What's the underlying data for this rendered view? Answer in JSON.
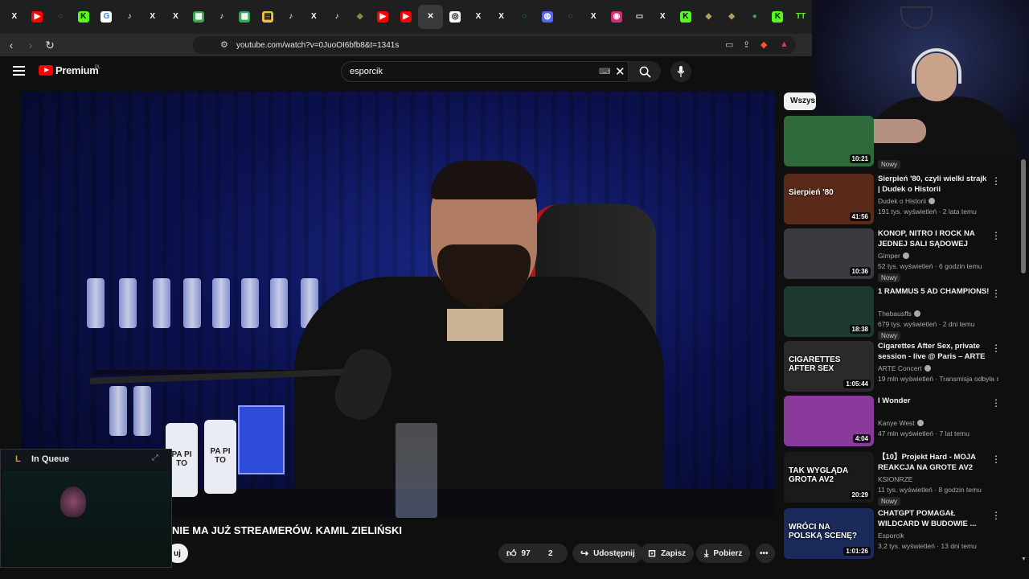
{
  "browser": {
    "tabs": [
      {
        "icon": "x-icon",
        "glyph": "X",
        "color": "#ffffff",
        "bg": "transparent"
      },
      {
        "icon": "youtube-icon",
        "glyph": "▶",
        "color": "#ffffff",
        "bg": "#ff0000"
      },
      {
        "icon": "refresh-icon",
        "glyph": "◌",
        "color": "#19c3a9",
        "bg": "transparent"
      },
      {
        "icon": "kick-icon",
        "glyph": "K",
        "color": "#000000",
        "bg": "#53fc18"
      },
      {
        "icon": "google-icon",
        "glyph": "G",
        "color": "#4285f4",
        "bg": "#ffffff"
      },
      {
        "icon": "tiktok-icon",
        "glyph": "♪",
        "color": "#ffffff",
        "bg": "transparent"
      },
      {
        "icon": "x-icon",
        "glyph": "X",
        "color": "#ffffff",
        "bg": "transparent"
      },
      {
        "icon": "x-icon",
        "glyph": "X",
        "color": "#ffffff",
        "bg": "transparent"
      },
      {
        "icon": "sheets-icon",
        "glyph": "▦",
        "color": "#ffffff",
        "bg": "#34a853"
      },
      {
        "icon": "tiktok-icon",
        "glyph": "♪",
        "color": "#ffffff",
        "bg": "transparent"
      },
      {
        "icon": "sheets-icon",
        "glyph": "▦",
        "color": "#ffffff",
        "bg": "#34a853"
      },
      {
        "icon": "doc-icon",
        "glyph": "▤",
        "color": "#000000",
        "bg": "#f0c040"
      },
      {
        "icon": "tiktok-icon",
        "glyph": "♪",
        "color": "#ffffff",
        "bg": "transparent"
      },
      {
        "icon": "x-icon",
        "glyph": "X",
        "color": "#ffffff",
        "bg": "transparent"
      },
      {
        "icon": "tiktok-icon",
        "glyph": "♪",
        "color": "#ffffff",
        "bg": "transparent"
      },
      {
        "icon": "leaf-icon",
        "glyph": "◆",
        "color": "#8a8a40",
        "bg": "transparent"
      },
      {
        "icon": "youtube-icon",
        "glyph": "▶",
        "color": "#ffffff",
        "bg": "#ff0000"
      },
      {
        "icon": "youtube-icon",
        "glyph": "▶",
        "color": "#ffffff",
        "bg": "#ff0000"
      },
      {
        "icon": "close-icon",
        "glyph": "✕",
        "color": "#ffffff",
        "bg": "transparent",
        "active": true
      },
      {
        "icon": "chatgpt-icon",
        "glyph": "◎",
        "color": "#000000",
        "bg": "#ffffff"
      },
      {
        "icon": "x-icon",
        "glyph": "X",
        "color": "#ffffff",
        "bg": "transparent"
      },
      {
        "icon": "x-icon",
        "glyph": "X",
        "color": "#ffffff",
        "bg": "transparent"
      },
      {
        "icon": "refresh-icon",
        "glyph": "◌",
        "color": "#19c3a9",
        "bg": "transparent"
      },
      {
        "icon": "discord-icon",
        "glyph": "◍",
        "color": "#ffffff",
        "bg": "#5865f2"
      },
      {
        "icon": "refresh-icon",
        "glyph": "◌",
        "color": "#19c3a9",
        "bg": "transparent"
      },
      {
        "icon": "x-icon",
        "glyph": "X",
        "color": "#ffffff",
        "bg": "transparent"
      },
      {
        "icon": "instagram-icon",
        "glyph": "◉",
        "color": "#ffffff",
        "bg": "#d62976"
      },
      {
        "icon": "gamepad-icon",
        "glyph": "▭",
        "color": "#dddddd",
        "bg": "transparent"
      },
      {
        "icon": "x-icon",
        "glyph": "X",
        "color": "#ffffff",
        "bg": "transparent"
      },
      {
        "icon": "kick-icon",
        "glyph": "K",
        "color": "#000000",
        "bg": "#53fc18"
      },
      {
        "icon": "leaf-icon",
        "glyph": "◆",
        "color": "#b0a060",
        "bg": "transparent"
      },
      {
        "icon": "leaf-icon",
        "glyph": "◆",
        "color": "#b0a060",
        "bg": "transparent"
      },
      {
        "icon": "maps-icon",
        "glyph": "●",
        "color": "#34a853",
        "bg": "transparent"
      },
      {
        "icon": "kick-icon",
        "glyph": "K",
        "color": "#000000",
        "bg": "#53fc18"
      },
      {
        "icon": "tt-icon",
        "glyph": "TT",
        "color": "#53fc18",
        "bg": "transparent"
      }
    ],
    "url": "youtube.com/watch?v=0JuoOI6bfb8&t=1341s"
  },
  "youtube": {
    "logo_text": "Premium",
    "logo_region": "PL",
    "search_value": "esporcik",
    "video_title_visible": "NIE MA JUŻ STREAMERÓW. KAMIL ZIELIŃSKI",
    "subscribe_partial": "uj",
    "likes": "97",
    "dislikes": "2",
    "share_label": "Udostępnij",
    "save_label": "Zapisz",
    "download_label": "Pobierz",
    "filter_chip": "Wszys",
    "colors": {
      "accent_red": "#ff0000",
      "background": "#0f0f0f"
    }
  },
  "queue_overlay": {
    "title": "In Queue"
  },
  "suggestions": [
    {
      "title": "",
      "channel": "",
      "meta": "",
      "duration": "10:21",
      "new": "Nowy",
      "thumb": "#2f6b3a"
    },
    {
      "title": "Sierpień '80, czyli wielki strajk | Dudek o Historii",
      "channel": "Dudek o Historii",
      "verified": true,
      "meta": "191 tys. wyświetleń · 2 lata temu",
      "duration": "41:56",
      "new": "",
      "thumb": "#5a2a1a",
      "thumb_text": "Sierpień '80"
    },
    {
      "title": "KONOP, NITRO I ROCK NA JEDNEJ SALI SĄDOWEJ",
      "channel": "Gimper",
      "verified": true,
      "meta": "52 tys. wyświetleń · 6 godzin temu",
      "duration": "10:36",
      "new": "Nowy",
      "thumb": "#3a3a40",
      "thumb_text": ""
    },
    {
      "title": "1 RAMMUS 5 AD CHAMPIONS!",
      "channel": "Thebausffs",
      "verified": true,
      "meta": "679 tys. wyświetleń · 2 dni temu",
      "duration": "18:38",
      "new": "Nowy",
      "thumb": "#1e3a2e",
      "thumb_text": ""
    },
    {
      "title": "Cigarettes After Sex, private session - live @ Paris – ARTE ...",
      "channel": "ARTE Concert",
      "verified": true,
      "meta": "19 mln wyświetleń · Transmisja odbyła s...",
      "duration": "1:05:44",
      "new": "",
      "thumb": "#2a2a2a",
      "thumb_text": "CIGARETTES AFTER SEX"
    },
    {
      "title": "I Wonder",
      "channel": "Kanye West",
      "verified": true,
      "meta": "47 mln wyświetleń · 7 lat temu",
      "duration": "4:04",
      "new": "",
      "thumb": "#8a3a9a",
      "thumb_text": ""
    },
    {
      "title": "【10】Projekt Hard - MOJA REAKCJA NA GROTE AV2 😱...",
      "channel": "KSIONRZE",
      "verified": false,
      "meta": "11 tys. wyświetleń · 8 godzin temu",
      "duration": "20:29",
      "new": "Nowy",
      "thumb": "#1a1a1a",
      "thumb_text": "TAK WYGLĄDA GROTA AV2"
    },
    {
      "title": "CHATGPT POMAGAŁ WILDCARD W BUDOWIE ...",
      "channel": "Esporcik",
      "verified": false,
      "meta": "3,2 tys. wyświetleń · 13 dni temu",
      "duration": "1:01:26",
      "new": "",
      "thumb": "#1a2a5a",
      "thumb_text": "WRÓCI NA POLSKĄ SCENĘ?"
    }
  ]
}
